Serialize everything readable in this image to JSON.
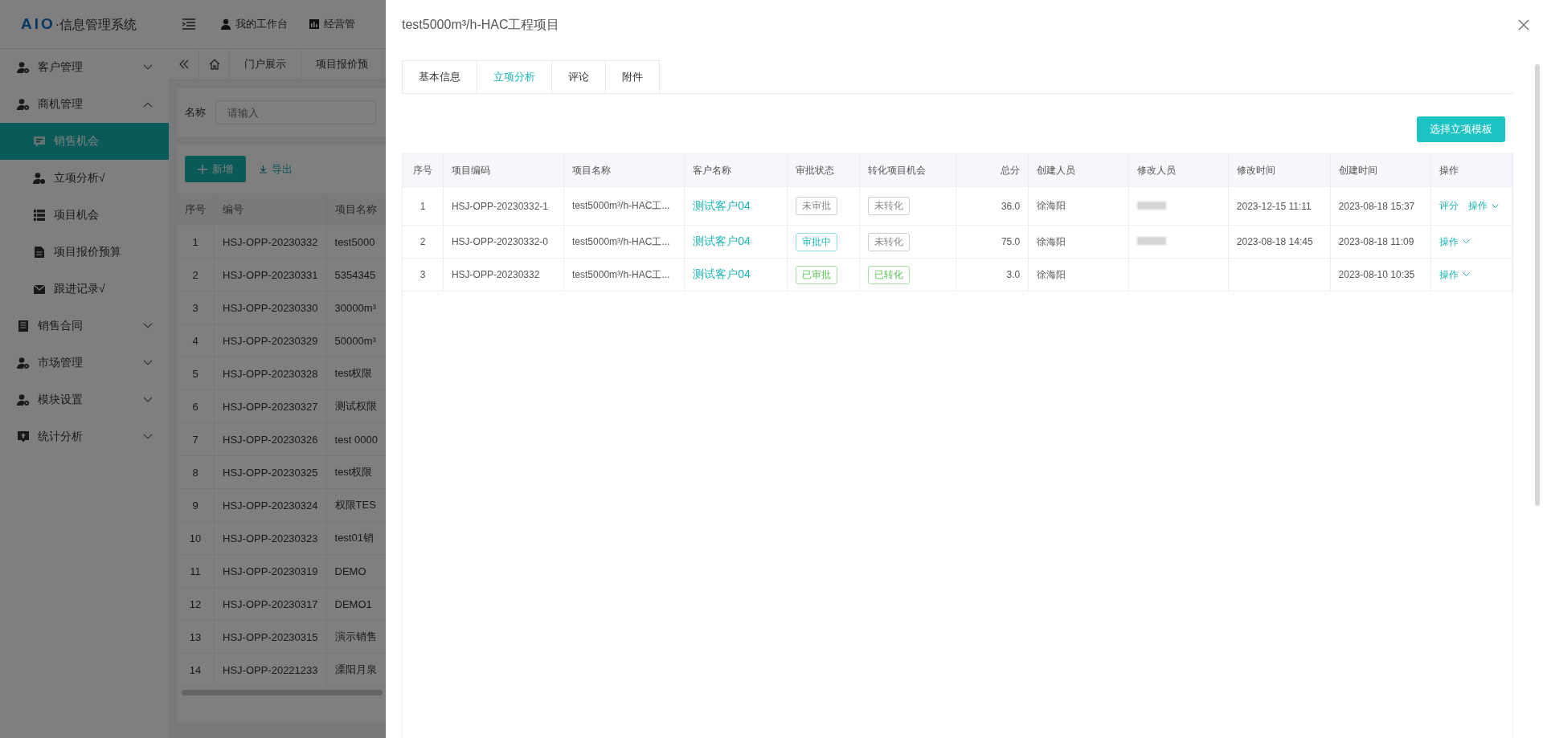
{
  "app": {
    "logo_mark": "AIO",
    "logo_text": "·信息管理系统",
    "header_nav": [
      {
        "label": "我的工作台"
      },
      {
        "label": "经营管"
      }
    ],
    "sidebar": {
      "items": [
        {
          "label": "客户管理",
          "expanded": false,
          "selected": false
        },
        {
          "label": "商机管理",
          "expanded": true,
          "selected": false,
          "children": [
            {
              "label": "销售机会",
              "selected": true
            },
            {
              "label": "立项分析√",
              "selected": false
            },
            {
              "label": "项目机会",
              "selected": false
            },
            {
              "label": "项目报价预算",
              "selected": false
            },
            {
              "label": "跟进记录√",
              "selected": false
            }
          ]
        },
        {
          "label": "销售合同",
          "expanded": false,
          "selected": false
        },
        {
          "label": "市场管理",
          "expanded": false,
          "selected": false
        },
        {
          "label": "模块设置",
          "expanded": false,
          "selected": false
        },
        {
          "label": "统计分析",
          "expanded": false,
          "selected": false
        }
      ]
    },
    "page_tabs": [
      "门户展示",
      "项目报价预"
    ],
    "filter": {
      "label": "名称",
      "placeholder": "请输入"
    },
    "buttons": {
      "add": "新增",
      "export": "导出"
    },
    "table": {
      "columns": [
        "序号",
        "编号",
        "项目名称"
      ],
      "rows": [
        [
          "1",
          "HSJ-OPP-20230332",
          "test5000"
        ],
        [
          "2",
          "HSJ-OPP-20230331",
          "5354345"
        ],
        [
          "3",
          "HSJ-OPP-20230330",
          "30000m³"
        ],
        [
          "4",
          "HSJ-OPP-20230329",
          "50000m³"
        ],
        [
          "5",
          "HSJ-OPP-20230328",
          "test权限"
        ],
        [
          "6",
          "HSJ-OPP-20230327",
          "测试权限"
        ],
        [
          "7",
          "HSJ-OPP-20230326",
          "test 0000"
        ],
        [
          "8",
          "HSJ-OPP-20230325",
          "test权限"
        ],
        [
          "9",
          "HSJ-OPP-20230324",
          "权限TES"
        ],
        [
          "10",
          "HSJ-OPP-20230323",
          "test01销"
        ],
        [
          "11",
          "HSJ-OPP-20230319",
          "DEMO"
        ],
        [
          "12",
          "HSJ-OPP-20230317",
          "DEMO1"
        ],
        [
          "13",
          "HSJ-OPP-20230315",
          "演示销售"
        ],
        [
          "14",
          "HSJ-OPP-20221233",
          "溧阳月泉"
        ]
      ]
    }
  },
  "drawer": {
    "title": "test5000m³/h-HAC工程项目",
    "tabs": [
      {
        "label": "基本信息",
        "selected": false
      },
      {
        "label": "立项分析",
        "selected": true
      },
      {
        "label": "评论",
        "selected": false
      },
      {
        "label": "附件",
        "selected": false
      }
    ],
    "primary_button": "选择立项模板",
    "table": {
      "columns": [
        "序号",
        "项目编码",
        "项目名称",
        "客户名称",
        "审批状态",
        "转化项目机会",
        "总分",
        "创建人员",
        "修改人员",
        "修改时间",
        "创建时间",
        "操作"
      ],
      "rows": [
        {
          "index": "1",
          "code": "HSJ-OPP-20230332-1",
          "name": "test5000m³/h-HAC工...",
          "customer": "测试客户04",
          "approval": {
            "label": "未审批",
            "kind": "pending"
          },
          "conversion": {
            "label": "未转化",
            "kind": "pending"
          },
          "score": "36.0",
          "creator": "徐海阳",
          "modifier_redacted": true,
          "modified_at": "2023-12-15 11:11",
          "created_at": "2023-08-18 15:37",
          "actions": [
            {
              "label": "评分",
              "kind": "link"
            },
            {
              "label": "操作",
              "kind": "dropdown"
            }
          ]
        },
        {
          "index": "2",
          "code": "HSJ-OPP-20230332-0",
          "name": "test5000m³/h-HAC工...",
          "customer": "测试客户04",
          "approval": {
            "label": "审批中",
            "kind": "progress"
          },
          "conversion": {
            "label": "未转化",
            "kind": "pending"
          },
          "score": "75.0",
          "creator": "徐海阳",
          "modifier_redacted": true,
          "modified_at": "2023-08-18 14:45",
          "created_at": "2023-08-18 11:09",
          "actions": [
            {
              "label": "操作",
              "kind": "dropdown"
            }
          ]
        },
        {
          "index": "3",
          "code": "HSJ-OPP-20230332",
          "name": "test5000m³/h-HAC工...",
          "customer": "测试客户04",
          "approval": {
            "label": "已审批",
            "kind": "done"
          },
          "conversion": {
            "label": "已转化",
            "kind": "done"
          },
          "score": "3.0",
          "creator": "徐海阳",
          "created_at": "2023-08-10 10:35",
          "actions": [
            {
              "label": "操作",
              "kind": "dropdown"
            }
          ]
        }
      ]
    }
  }
}
